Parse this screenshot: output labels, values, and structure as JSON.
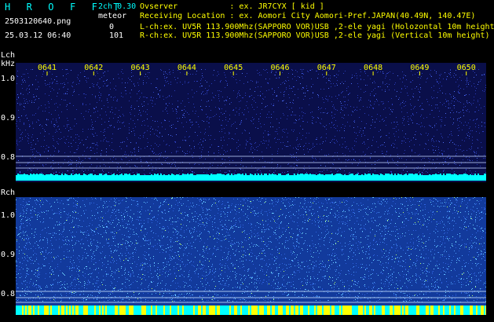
{
  "header": {
    "title": "H R O F F T",
    "version": "2ch 0.30",
    "filename": "2503120640.png",
    "datetime": "25.03.12 06:40",
    "meteor_label": "meteor",
    "lch_count": "0",
    "rch_count": "101"
  },
  "info": [
    "Ovserver           : ex. JR7CYX [ kid ]",
    "Receiving Location : ex. Aomori City Aomori-Pref.JAPAN(40.49N, 140.47E)",
    "L-ch:ex. UV5R 113.900Mhz(SAPPORO VOR)USB ,2-ele yagi (Holozontal 10m height)",
    "R-ch:ex. UV5R 113.900Mhz(SAPPORO VOR)USB ,2-ele yagi (Vertical 10m height)"
  ],
  "lch": {
    "channel_label": "Lch",
    "unit_label": "kHz",
    "y_ticks": [
      "1.0",
      "0.9",
      "0.8"
    ],
    "time_ticks": [
      "0641",
      "0642",
      "0643",
      "0644",
      "0645",
      "0646",
      "0647",
      "0648",
      "0649",
      "0650"
    ]
  },
  "rch": {
    "channel_label": "Rch",
    "y_ticks": [
      "1.0",
      "0.9",
      "0.8"
    ]
  },
  "colors": {
    "lch_background": "#0a0f4a",
    "rch_background": "#123a9c",
    "noise_band": "#00ffff",
    "meteor_bar": "#ffff00",
    "label_cyan": "#00ffff",
    "label_yellow": "#ffff00"
  }
}
